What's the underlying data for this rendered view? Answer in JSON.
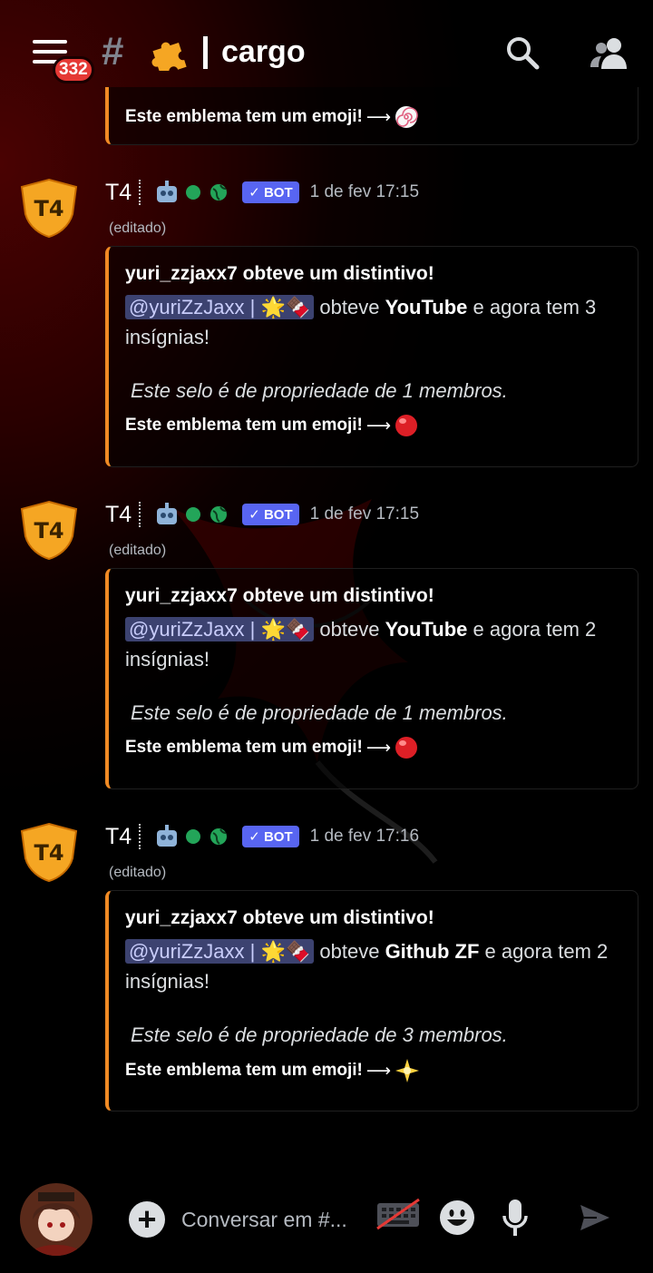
{
  "header": {
    "notification_count": "332",
    "hash": "#",
    "channel_name": "cargo"
  },
  "top_embed": {
    "emblem_text": "Este emblema tem um emoji!",
    "arrow": "⟶"
  },
  "messages": [
    {
      "author": "T4",
      "bot_label": "BOT",
      "timestamp": "1 de fev 17:15",
      "edited": "(editado)",
      "embed": {
        "title": "yuri_zzjaxx7 obteve um distintivo!",
        "mention": "@yuriZzJaxx",
        "pipe": "|",
        "obteve": "obteve",
        "badge_name": "YouTube",
        "rest": "e agora tem 3 insígnias!",
        "selo": "Este selo é de propriedade de 1 membros.",
        "emblem_text": "Este emblema tem um emoji!",
        "arrow": "⟶",
        "emoji": "red-circle"
      }
    },
    {
      "author": "T4",
      "bot_label": "BOT",
      "timestamp": "1 de fev 17:15",
      "edited": "(editado)",
      "embed": {
        "title": "yuri_zzjaxx7 obteve um distintivo!",
        "mention": "@yuriZzJaxx",
        "pipe": "|",
        "obteve": "obteve",
        "badge_name": "YouTube",
        "rest": "e agora tem 2 insígnias!",
        "selo": "Este selo é de propriedade de 1 membros.",
        "emblem_text": "Este emblema tem um emoji!",
        "arrow": "⟶",
        "emoji": "red-circle"
      }
    },
    {
      "author": "T4",
      "bot_label": "BOT",
      "timestamp": "1 de fev 17:16",
      "edited": "(editado)",
      "embed": {
        "title": "yuri_zzjaxx7 obteve um distintivo!",
        "mention": "@yuriZzJaxx",
        "pipe": "|",
        "obteve": "obteve",
        "badge_name": "Github ZF",
        "rest": "e agora tem 2 insígnias!",
        "selo": "Este selo é de propriedade de 3 membros.",
        "emblem_text": "Este emblema tem um emoji!",
        "arrow": "⟶",
        "emoji": "sparkle-star"
      }
    }
  ],
  "composer": {
    "placeholder": "Conversar em #..."
  },
  "colors": {
    "accent_orange": "#f08a24",
    "bot_tag": "#5865f2",
    "online": "#23a559",
    "badge_red": "#e53935"
  }
}
